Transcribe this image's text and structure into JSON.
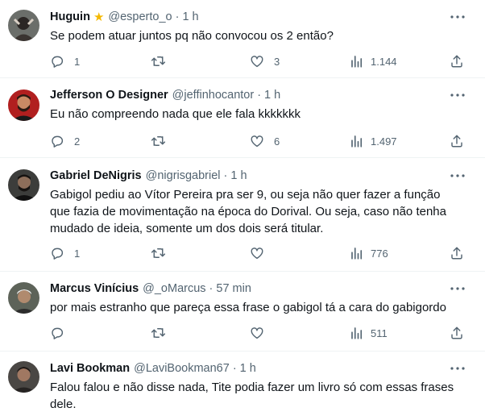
{
  "tweets": [
    {
      "name": "Huguin",
      "verified_icon": "star-icon",
      "handle": "@esperto_o",
      "time": "1 h",
      "text": "Se podem atuar juntos pq não convocou os 2 então?",
      "replies": "1",
      "retweets": "",
      "likes": "3",
      "views": "1.144"
    },
    {
      "name": "Jefferson O Designer",
      "handle": "@jeffinhocantor",
      "time": "1 h",
      "text": "Eu não compreendo nada que ele fala kkkkkkk",
      "replies": "2",
      "retweets": "",
      "likes": "6",
      "views": "1.497"
    },
    {
      "name": "Gabriel DeNigris",
      "handle": "@nigrisgabriel",
      "time": "1 h",
      "text": "Gabigol pediu ao Vítor Pereira pra ser 9, ou seja não quer fazer a função\nque fazia de movimentação na época do Dorival. Ou seja, caso não tenha\nmudado de ideia, somente um dos dois será titular.",
      "replies": "1",
      "retweets": "",
      "likes": "",
      "views": "776"
    },
    {
      "name": "Marcus Vinícius",
      "handle": "@_oMarcus",
      "time": "57 min",
      "text": "por mais estranho que pareça essa frase o gabigol tá a cara do gabigordo",
      "replies": "",
      "retweets": "",
      "likes": "",
      "views": "511"
    },
    {
      "name": "Lavi Bookman",
      "handle": "@LaviBookman67",
      "time": "1 h",
      "text": "Falou falou e não disse nada, Tite podia fazer um livro só com essas frases\ndele."
    }
  ],
  "colors": {
    "text": "#0f1419",
    "secondary": "#536471",
    "border": "#eff3f4",
    "star": "#f5b800"
  },
  "icons": [
    "reply-icon",
    "retweet-icon",
    "like-icon",
    "views-icon",
    "share-icon",
    "more-icon"
  ]
}
